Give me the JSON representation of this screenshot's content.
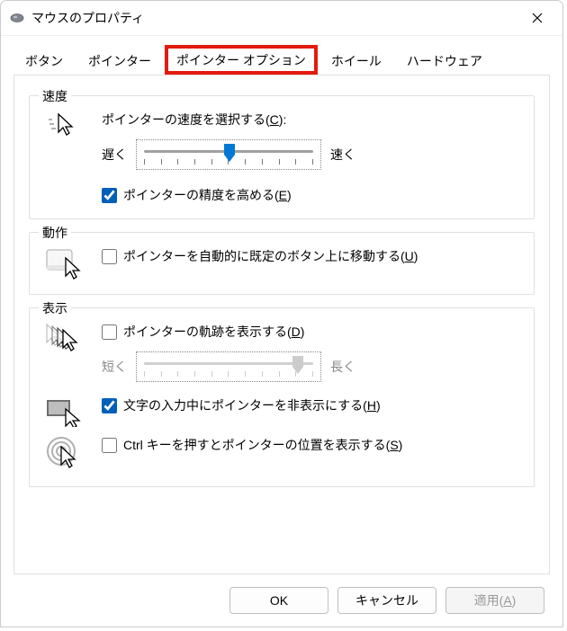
{
  "titlebar": {
    "title": "マウスのプロパティ"
  },
  "tabs": {
    "0": "ボタン",
    "1": "ポインター",
    "2": "ポインター オプション",
    "3": "ホイール",
    "4": "ハードウェア",
    "active_index": 2
  },
  "speed": {
    "legend": "速度",
    "select_label_prefix": "ポインターの速度を選択する(",
    "select_accel": "C",
    "select_label_suffix": "):",
    "slow": "遅く",
    "fast": "速く",
    "slider": {
      "min": 1,
      "max": 11,
      "value": 6
    },
    "enhance_prefix": "ポインターの精度を高める(",
    "enhance_accel": "E",
    "enhance_suffix": ")",
    "enhance_checked": true
  },
  "motion": {
    "legend": "動作",
    "snap_prefix": "ポインターを自動的に既定のボタン上に移動する(",
    "snap_accel": "U",
    "snap_suffix": ")",
    "snap_checked": false
  },
  "display": {
    "legend": "表示",
    "trails_prefix": "ポインターの軌跡を表示する(",
    "trails_accel": "D",
    "trails_suffix": ")",
    "trails_checked": false,
    "short": "短く",
    "long": "長く",
    "trail_slider": {
      "min": 1,
      "max": 11,
      "value": 10,
      "enabled": false
    },
    "hide_prefix": "文字の入力中にポインターを非表示にする(",
    "hide_accel": "H",
    "hide_suffix": ")",
    "hide_checked": true,
    "ctrl_prefix": "Ctrl キーを押すとポインターの位置を表示する(",
    "ctrl_accel": "S",
    "ctrl_suffix": ")",
    "ctrl_checked": false
  },
  "buttons": {
    "ok": "OK",
    "cancel": "キャンセル",
    "apply_prefix": "適用(",
    "apply_accel": "A",
    "apply_suffix": ")",
    "apply_enabled": false
  }
}
